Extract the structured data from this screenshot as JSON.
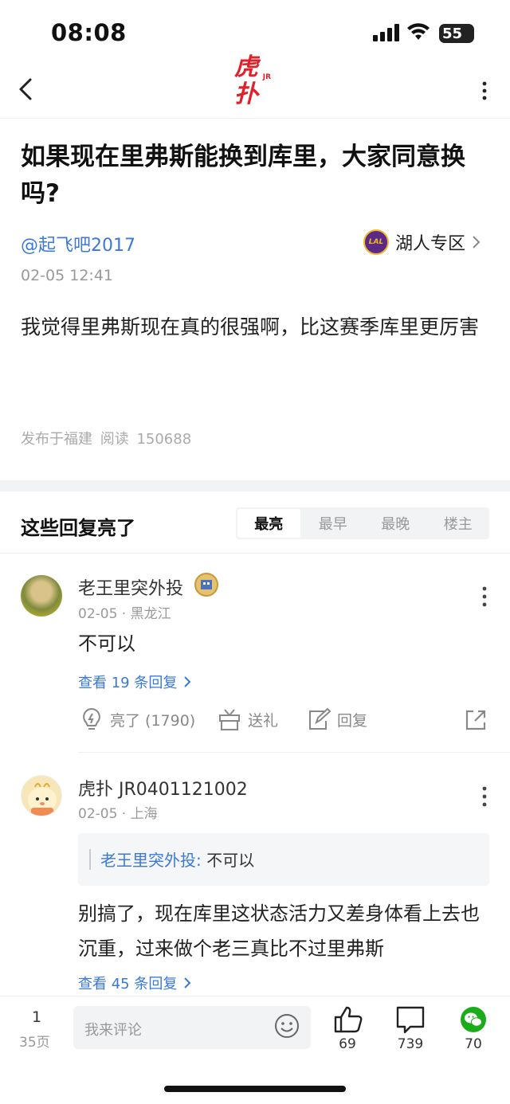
{
  "status_bar": {
    "time": "08:08",
    "battery": "55"
  },
  "header": {
    "logo_text": "虎扑",
    "logo_sup": "JR"
  },
  "article": {
    "title": "如果现在里弗斯能换到库里，大家同意换吗?",
    "author": "@起飞吧2017",
    "zone": "湖人专区",
    "zone_logo": "LAL",
    "date": "02-05 12:41",
    "content": "我觉得里弗斯现在真的很强啊，比这赛季库里更厉害",
    "meta": "发布于福建  阅读 150688"
  },
  "replies": {
    "title": "这些回复亮了",
    "tabs": [
      "最亮",
      "最早",
      "最晚",
      "楼主"
    ],
    "comments": [
      {
        "name": "老王里突外投",
        "sub": "02-05 · 黑龙江",
        "text": "不可以",
        "view_replies": "查看 19 条回复",
        "actions": {
          "light": "亮了 (1790)",
          "gift": "送礼",
          "reply": "回复"
        }
      },
      {
        "name": "虎扑 JR0401121002",
        "sub": "02-05 · 上海",
        "quote_name": "老王里突外投:",
        "quote_text": " 不可以",
        "text": "别搞了，现在库里这状态活力又差身体看上去也沉重，过来做个老三真比不过里弗斯",
        "view_replies": "查看 45 条回复"
      }
    ]
  },
  "bottom_bar": {
    "page_current": "1",
    "page_total": "35页",
    "comment_placeholder": "我来评论",
    "likes": "69",
    "comments": "739",
    "shares": "70"
  },
  "colors": {
    "accent": "#3b79d6",
    "logo_red": "#e0202a",
    "wechat": "#1aad19"
  }
}
